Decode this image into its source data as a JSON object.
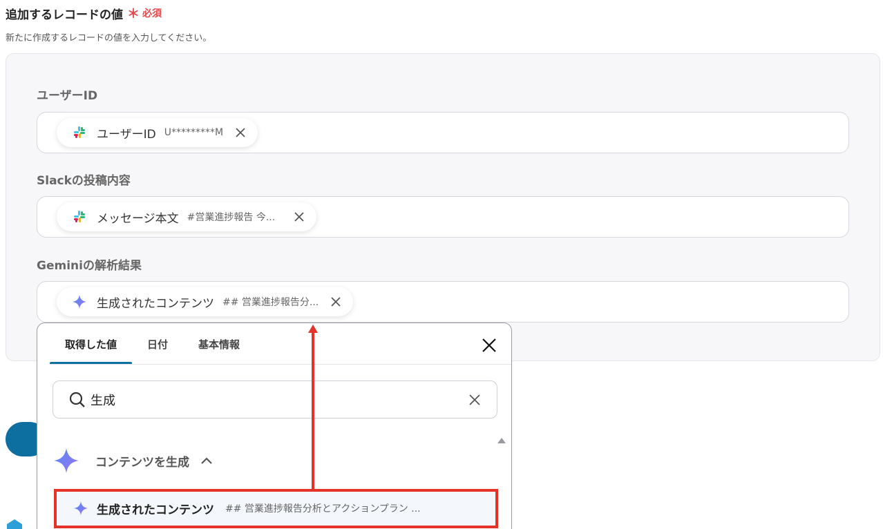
{
  "section": {
    "title": "追加するレコードの値",
    "required_mark": "＊",
    "required_label": "必須",
    "description": "新たに作成するレコードの値を入力してください。"
  },
  "fields": [
    {
      "label": "ユーザーID",
      "chip_name": "ユーザーID",
      "chip_value": "U*********M",
      "chip_icon": "slack-icon"
    },
    {
      "label": "Slackの投稿内容",
      "chip_name": "メッセージ本文",
      "chip_value": "#営業進捗報告 今...",
      "chip_icon": "slack-icon"
    },
    {
      "label": "Geminiの解析結果",
      "chip_name": "生成されたコンテンツ",
      "chip_value": "## 営業進捗報告分...",
      "chip_icon": "gemini-sparkle-icon"
    }
  ],
  "popup": {
    "tabs": [
      "取得した値",
      "日付",
      "基本情報"
    ],
    "active_tab": "取得した値",
    "search_value": "生成",
    "group_label": "コンテンツを生成",
    "result_name": "生成されたコンテンツ",
    "result_value": "## 営業進捗報告分析とアクションプラン ..."
  },
  "colors": {
    "accent": "#0c6fa0",
    "required": "#e5484d",
    "highlight": "#e5332a",
    "panel_bg": "#f7f7f9"
  }
}
